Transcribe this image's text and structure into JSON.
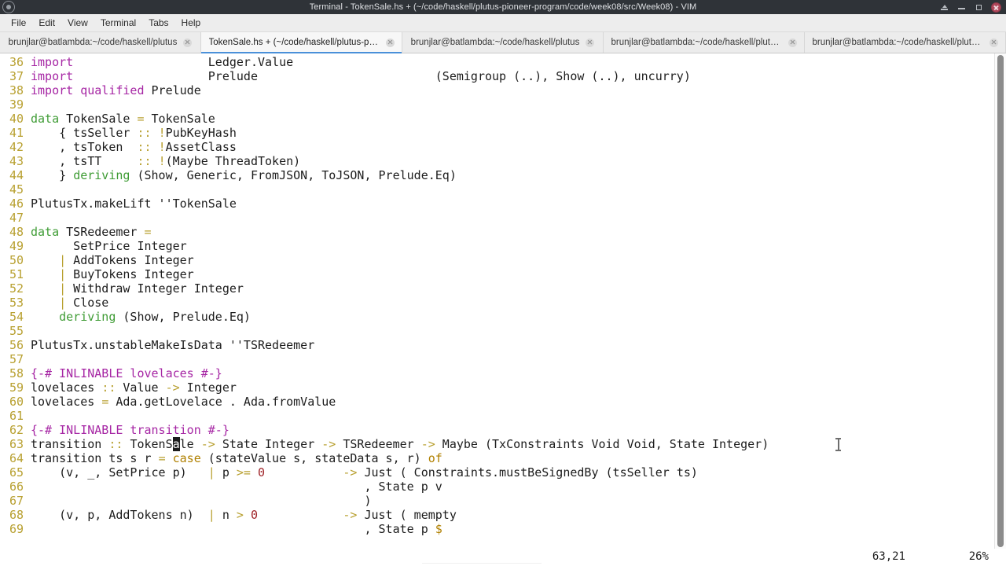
{
  "window": {
    "title": "Terminal - TokenSale.hs + (~/code/haskell/plutus-pioneer-program/code/week08/src/Week08) - VIM",
    "app_icon": "terminal-icon",
    "controls": {
      "shade_label": "",
      "minimize_label": "",
      "maximize_label": "",
      "close_label": ""
    }
  },
  "menubar": {
    "items": [
      {
        "label": "File"
      },
      {
        "label": "Edit"
      },
      {
        "label": "View"
      },
      {
        "label": "Terminal"
      },
      {
        "label": "Tabs"
      },
      {
        "label": "Help"
      }
    ]
  },
  "tabs": [
    {
      "label": "brunjlar@batlambda:~/code/haskell/plutus",
      "active": false
    },
    {
      "label": "TokenSale.hs + (~/code/haskell/plutus-pionee...",
      "active": true
    },
    {
      "label": "brunjlar@batlambda:~/code/haskell/plutus",
      "active": false
    },
    {
      "label": "brunjlar@batlambda:~/code/haskell/plutus-p...",
      "active": false
    },
    {
      "label": "brunjlar@batlambda:~/code/haskell/plutus-h...",
      "active": false
    }
  ],
  "editor": {
    "accent_color": "#4a90d9",
    "keyword_color": "#a626a4",
    "type_color": "#3f9c35",
    "operator_color": "#b8a030",
    "number_color": "#a0252a",
    "linenum_color": "#b8a030",
    "lines": [
      {
        "n": "36",
        "text": "import                   Ledger.Value"
      },
      {
        "n": "37",
        "text": "import                   Prelude                         (Semigroup (..), Show (..), uncurry)"
      },
      {
        "n": "38",
        "text": "import qualified Prelude"
      },
      {
        "n": "39",
        "text": ""
      },
      {
        "n": "40",
        "text": "data TokenSale = TokenSale"
      },
      {
        "n": "41",
        "text": "    { tsSeller :: !PubKeyHash"
      },
      {
        "n": "42",
        "text": "    , tsToken  :: !AssetClass"
      },
      {
        "n": "43",
        "text": "    , tsTT     :: !(Maybe ThreadToken)"
      },
      {
        "n": "44",
        "text": "    } deriving (Show, Generic, FromJSON, ToJSON, Prelude.Eq)"
      },
      {
        "n": "45",
        "text": ""
      },
      {
        "n": "46",
        "text": "PlutusTx.makeLift ''TokenSale"
      },
      {
        "n": "47",
        "text": ""
      },
      {
        "n": "48",
        "text": "data TSRedeemer ="
      },
      {
        "n": "49",
        "text": "      SetPrice Integer"
      },
      {
        "n": "50",
        "text": "    | AddTokens Integer"
      },
      {
        "n": "51",
        "text": "    | BuyTokens Integer"
      },
      {
        "n": "52",
        "text": "    | Withdraw Integer Integer"
      },
      {
        "n": "53",
        "text": "    | Close"
      },
      {
        "n": "54",
        "text": "    deriving (Show, Prelude.Eq)"
      },
      {
        "n": "55",
        "text": ""
      },
      {
        "n": "56",
        "text": "PlutusTx.unstableMakeIsData ''TSRedeemer"
      },
      {
        "n": "57",
        "text": ""
      },
      {
        "n": "58",
        "text": "{-# INLINABLE lovelaces #-}"
      },
      {
        "n": "59",
        "text": "lovelaces :: Value -> Integer"
      },
      {
        "n": "60",
        "text": "lovelaces = Ada.getLovelace . Ada.fromValue"
      },
      {
        "n": "61",
        "text": ""
      },
      {
        "n": "62",
        "text": "{-# INLINABLE transition #-}"
      },
      {
        "n": "63",
        "text": "transition :: TokenSale -> State Integer -> TSRedeemer -> Maybe (TxConstraints Void Void, State Integer)"
      },
      {
        "n": "64",
        "text": "transition ts s r = case (stateValue s, stateData s, r) of"
      },
      {
        "n": "65",
        "text": "    (v, _, SetPrice p)   | p >= 0           -> Just ( Constraints.mustBeSignedBy (tsSeller ts)"
      },
      {
        "n": "66",
        "text": "                                               , State p v"
      },
      {
        "n": "67",
        "text": "                                               )"
      },
      {
        "n": "68",
        "text": "    (v, p, AddTokens n)  | n > 0            -> Just ( mempty"
      },
      {
        "n": "69",
        "text": "                                               , State p $"
      }
    ],
    "cursor": {
      "line": "63",
      "column": "21",
      "char": "a"
    }
  },
  "statusbar": {
    "ruler": "63,21",
    "percent": "26%"
  }
}
